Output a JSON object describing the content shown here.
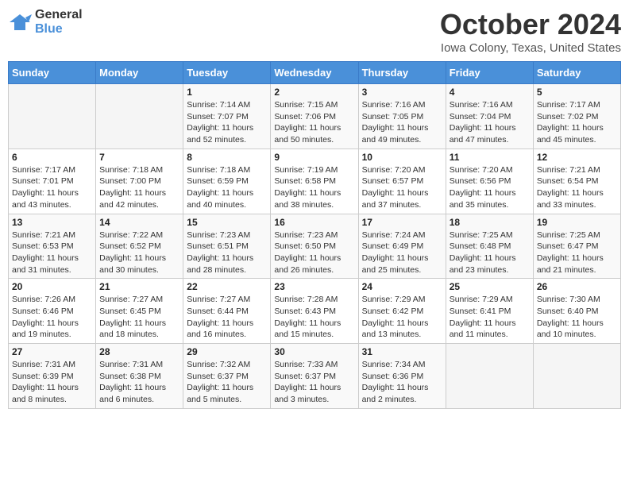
{
  "header": {
    "logo_line1": "General",
    "logo_line2": "Blue",
    "title": "October 2024",
    "subtitle": "Iowa Colony, Texas, United States"
  },
  "days_of_week": [
    "Sunday",
    "Monday",
    "Tuesday",
    "Wednesday",
    "Thursday",
    "Friday",
    "Saturday"
  ],
  "weeks": [
    [
      {
        "day": "",
        "info": ""
      },
      {
        "day": "",
        "info": ""
      },
      {
        "day": "1",
        "info": "Sunrise: 7:14 AM\nSunset: 7:07 PM\nDaylight: 11 hours and 52 minutes."
      },
      {
        "day": "2",
        "info": "Sunrise: 7:15 AM\nSunset: 7:06 PM\nDaylight: 11 hours and 50 minutes."
      },
      {
        "day": "3",
        "info": "Sunrise: 7:16 AM\nSunset: 7:05 PM\nDaylight: 11 hours and 49 minutes."
      },
      {
        "day": "4",
        "info": "Sunrise: 7:16 AM\nSunset: 7:04 PM\nDaylight: 11 hours and 47 minutes."
      },
      {
        "day": "5",
        "info": "Sunrise: 7:17 AM\nSunset: 7:02 PM\nDaylight: 11 hours and 45 minutes."
      }
    ],
    [
      {
        "day": "6",
        "info": "Sunrise: 7:17 AM\nSunset: 7:01 PM\nDaylight: 11 hours and 43 minutes."
      },
      {
        "day": "7",
        "info": "Sunrise: 7:18 AM\nSunset: 7:00 PM\nDaylight: 11 hours and 42 minutes."
      },
      {
        "day": "8",
        "info": "Sunrise: 7:18 AM\nSunset: 6:59 PM\nDaylight: 11 hours and 40 minutes."
      },
      {
        "day": "9",
        "info": "Sunrise: 7:19 AM\nSunset: 6:58 PM\nDaylight: 11 hours and 38 minutes."
      },
      {
        "day": "10",
        "info": "Sunrise: 7:20 AM\nSunset: 6:57 PM\nDaylight: 11 hours and 37 minutes."
      },
      {
        "day": "11",
        "info": "Sunrise: 7:20 AM\nSunset: 6:56 PM\nDaylight: 11 hours and 35 minutes."
      },
      {
        "day": "12",
        "info": "Sunrise: 7:21 AM\nSunset: 6:54 PM\nDaylight: 11 hours and 33 minutes."
      }
    ],
    [
      {
        "day": "13",
        "info": "Sunrise: 7:21 AM\nSunset: 6:53 PM\nDaylight: 11 hours and 31 minutes."
      },
      {
        "day": "14",
        "info": "Sunrise: 7:22 AM\nSunset: 6:52 PM\nDaylight: 11 hours and 30 minutes."
      },
      {
        "day": "15",
        "info": "Sunrise: 7:23 AM\nSunset: 6:51 PM\nDaylight: 11 hours and 28 minutes."
      },
      {
        "day": "16",
        "info": "Sunrise: 7:23 AM\nSunset: 6:50 PM\nDaylight: 11 hours and 26 minutes."
      },
      {
        "day": "17",
        "info": "Sunrise: 7:24 AM\nSunset: 6:49 PM\nDaylight: 11 hours and 25 minutes."
      },
      {
        "day": "18",
        "info": "Sunrise: 7:25 AM\nSunset: 6:48 PM\nDaylight: 11 hours and 23 minutes."
      },
      {
        "day": "19",
        "info": "Sunrise: 7:25 AM\nSunset: 6:47 PM\nDaylight: 11 hours and 21 minutes."
      }
    ],
    [
      {
        "day": "20",
        "info": "Sunrise: 7:26 AM\nSunset: 6:46 PM\nDaylight: 11 hours and 19 minutes."
      },
      {
        "day": "21",
        "info": "Sunrise: 7:27 AM\nSunset: 6:45 PM\nDaylight: 11 hours and 18 minutes."
      },
      {
        "day": "22",
        "info": "Sunrise: 7:27 AM\nSunset: 6:44 PM\nDaylight: 11 hours and 16 minutes."
      },
      {
        "day": "23",
        "info": "Sunrise: 7:28 AM\nSunset: 6:43 PM\nDaylight: 11 hours and 15 minutes."
      },
      {
        "day": "24",
        "info": "Sunrise: 7:29 AM\nSunset: 6:42 PM\nDaylight: 11 hours and 13 minutes."
      },
      {
        "day": "25",
        "info": "Sunrise: 7:29 AM\nSunset: 6:41 PM\nDaylight: 11 hours and 11 minutes."
      },
      {
        "day": "26",
        "info": "Sunrise: 7:30 AM\nSunset: 6:40 PM\nDaylight: 11 hours and 10 minutes."
      }
    ],
    [
      {
        "day": "27",
        "info": "Sunrise: 7:31 AM\nSunset: 6:39 PM\nDaylight: 11 hours and 8 minutes."
      },
      {
        "day": "28",
        "info": "Sunrise: 7:31 AM\nSunset: 6:38 PM\nDaylight: 11 hours and 6 minutes."
      },
      {
        "day": "29",
        "info": "Sunrise: 7:32 AM\nSunset: 6:37 PM\nDaylight: 11 hours and 5 minutes."
      },
      {
        "day": "30",
        "info": "Sunrise: 7:33 AM\nSunset: 6:37 PM\nDaylight: 11 hours and 3 minutes."
      },
      {
        "day": "31",
        "info": "Sunrise: 7:34 AM\nSunset: 6:36 PM\nDaylight: 11 hours and 2 minutes."
      },
      {
        "day": "",
        "info": ""
      },
      {
        "day": "",
        "info": ""
      }
    ]
  ]
}
